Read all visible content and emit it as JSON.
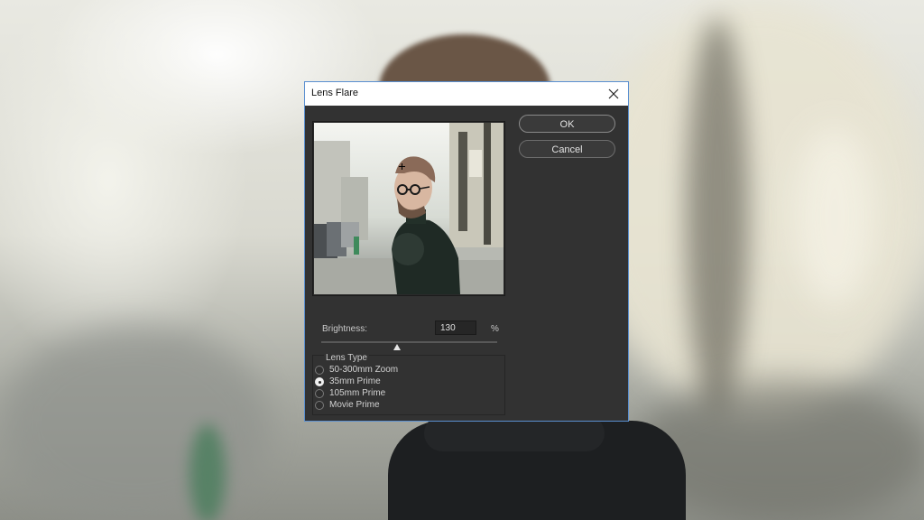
{
  "dialog": {
    "title": "Lens Flare",
    "ok_label": "OK",
    "cancel_label": "Cancel",
    "brightness": {
      "label": "Brightness:",
      "value": "130",
      "unit": "%",
      "slider_fraction": 0.43
    },
    "lens_type": {
      "legend": "Lens Type",
      "options": [
        {
          "label": "50-300mm Zoom",
          "checked": false
        },
        {
          "label": "35mm Prime",
          "checked": true
        },
        {
          "label": "105mm Prime",
          "checked": false
        },
        {
          "label": "Movie Prime",
          "checked": false
        }
      ]
    },
    "icons": {
      "close": "close-icon",
      "flare_center": "crosshair-icon",
      "slider": "triangle-slider-icon"
    },
    "colors": {
      "dialog_bg": "#323232",
      "title_bg": "#ffffff",
      "border": "#5a8fd0"
    }
  }
}
